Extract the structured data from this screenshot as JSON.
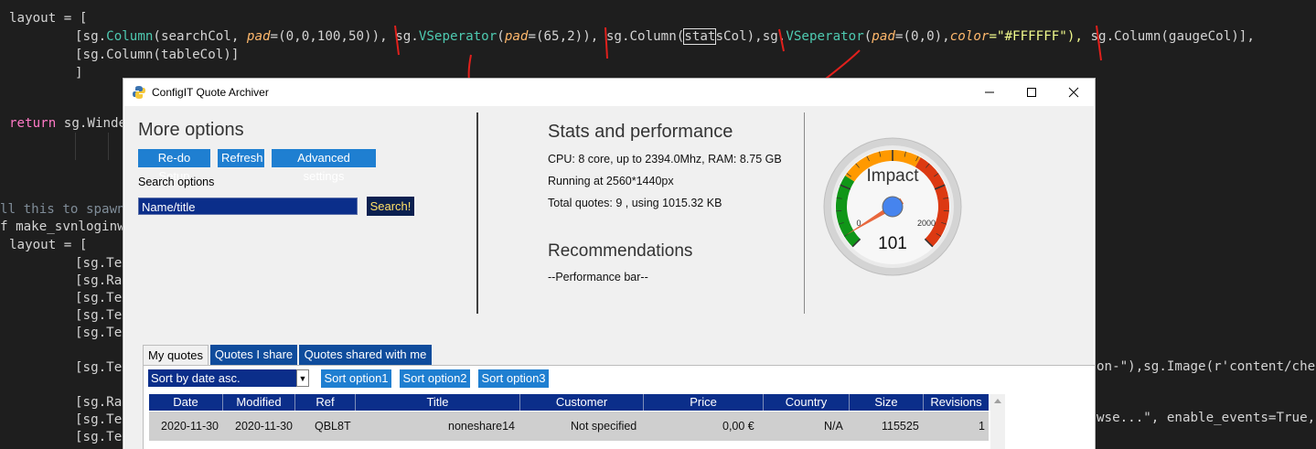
{
  "code": {
    "line1_var": "layout",
    "line1_rest": " = [",
    "line2": {
      "open": "[sg.",
      "column1": "Column",
      "arg1": "(searchCol, ",
      "pad_kw": "pad",
      "pad_val": "=(0,0,100,50)), ",
      "sep1": "sg.",
      "vsep1": "VSeperator",
      "vsep1_open": "(",
      "vsep1_pad": "pad",
      "vsep1_val": "=(65,2)), ",
      "col2": "sg.Column(",
      "col2_boxed": "stat",
      "col2_rest": "sCol),",
      "vsep2_prefix": "sg.",
      "vsep2": "VSeperator",
      "vsep2_open": "(",
      "vsep2_pad": "pad",
      "vsep2_val": "=(0,0),",
      "vsep2_color_kw": "color",
      "vsep2_color_val": "=\"#FFFFFF\"), ",
      "col3": "sg.Column(gaugeCol)],"
    },
    "line3": "[sg.Column(tableCol)]",
    "line4": "]",
    "return_kw": "return",
    "return_rest": " sg.Winde",
    "comment_tail": "ll this to spawn",
    "def_tail": "f make_svnloginw",
    "layout2": "layout",
    "layout2_rest": " = [",
    "sg_te": "[sg.Tex",
    "sg_ra": "[sg.Rad",
    "right_tail_1": "on-\"),sg.Image(r'content/che",
    "right_tail_2": "wse...\", enable_events=True,"
  },
  "window": {
    "title": "ConfigIT Quote Archiver",
    "minimize_icon": "minimize-icon",
    "maximize_icon": "maximize-icon",
    "close_icon": "close-icon"
  },
  "search": {
    "heading": "More options",
    "buttons": [
      "Re-do Setup",
      "Refresh",
      "Advanced settings"
    ],
    "options_label": "Search options",
    "input_value": "Name/title",
    "search_button": "Search!"
  },
  "stats": {
    "heading": "Stats and performance",
    "cpu": "CPU: 8 core, up to 2394.0Mhz, RAM: 8.75 GB",
    "running": "Running at 2560*1440px",
    "total": "Total quotes: 9 , using 1015.32 KB",
    "rec_heading": "Recommendations",
    "perf_bar": "--Performance bar--"
  },
  "gauge": {
    "label": "Impact",
    "min_label": "0",
    "max_label": "2000",
    "value_text": "101",
    "min": 0,
    "max": 2000,
    "value": 101,
    "colors": {
      "green": "#109618",
      "orange": "#FF9900",
      "red": "#DC3912",
      "needle": "#e8673d",
      "hub": "#4684ee"
    }
  },
  "tabs": [
    "My quotes",
    "Quotes I share",
    "Quotes shared with me"
  ],
  "sort": {
    "selected": "Sort by date asc.",
    "buttons": [
      "Sort option1",
      "Sort option2",
      "Sort option3"
    ]
  },
  "table": {
    "columns": [
      "Date",
      "Modified",
      "Ref",
      "Title",
      "Customer",
      "Price",
      "Country",
      "Size",
      "Revisions"
    ],
    "rows": [
      [
        "2020-11-30",
        "2020-11-30",
        "QBL8T",
        "noneshare14",
        "Not specified",
        "0,00 €",
        "N/A",
        "115525",
        "1"
      ]
    ]
  },
  "colors": {
    "accent_button": "#1f7fd1",
    "table_header": "#0b2e8a",
    "annotation_red": "#e0201c"
  }
}
